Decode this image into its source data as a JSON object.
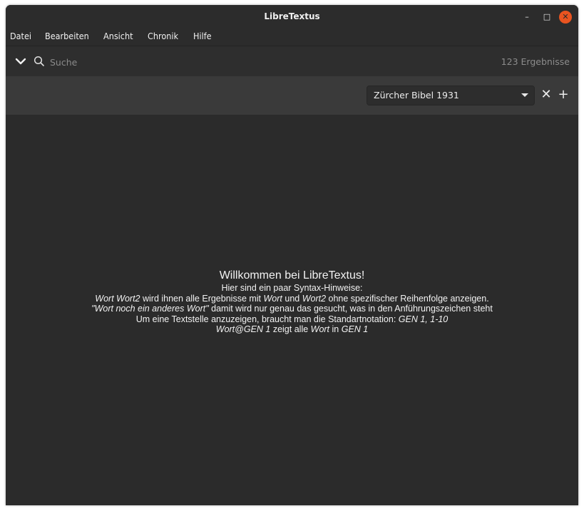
{
  "window": {
    "title": "LibreTextus",
    "controls": {
      "minimize": "–",
      "maximize": "□",
      "close": "✕"
    }
  },
  "menu": [
    "Datei",
    "Bearbeiten",
    "Ansicht",
    "Chronik",
    "Hilfe"
  ],
  "search": {
    "placeholder": "Suche",
    "value": "",
    "results_label": "123 Ergebnisse",
    "icons": [
      "chevron-down-icon",
      "search-icon"
    ]
  },
  "toolbar": {
    "translation": "Zürcher Bibel 1931",
    "close_label": "✕",
    "add_label": "+"
  },
  "welcome": {
    "title": "Willkommen bei LibreTextus!",
    "intro": "Hier sind ein paar Syntax-Hinweise:",
    "line1": {
      "ex1": "Wort Wort2",
      "t1": " wird ihnen alle Ergebnisse mit ",
      "ex2": "Wort",
      "t2": " und ",
      "ex3": "Wort2",
      "t3": " ohne spezifischer Reihenfolge anzeigen."
    },
    "line2": {
      "ex1": "\"Wort noch ein anderes Wort\"",
      "t1": " damit wird nur genau das gesucht, was in den Anführungszeichen steht"
    },
    "line3": {
      "t1": "Um eine Textstelle anzuzeigen, braucht man die Standartnotation: ",
      "ex1": "GEN 1, 1-10"
    },
    "line4": {
      "ex1": "Wort@GEN 1",
      "t1": " zeigt alle ",
      "ex2": "Wort",
      "t2": " in ",
      "ex3": "GEN 1"
    }
  },
  "colors": {
    "background": "#2b2b2b",
    "toolbar": "#3a3a3a",
    "close_accent": "#e95420",
    "text": "#f2f2f2",
    "muted": "#8c8c8c"
  }
}
